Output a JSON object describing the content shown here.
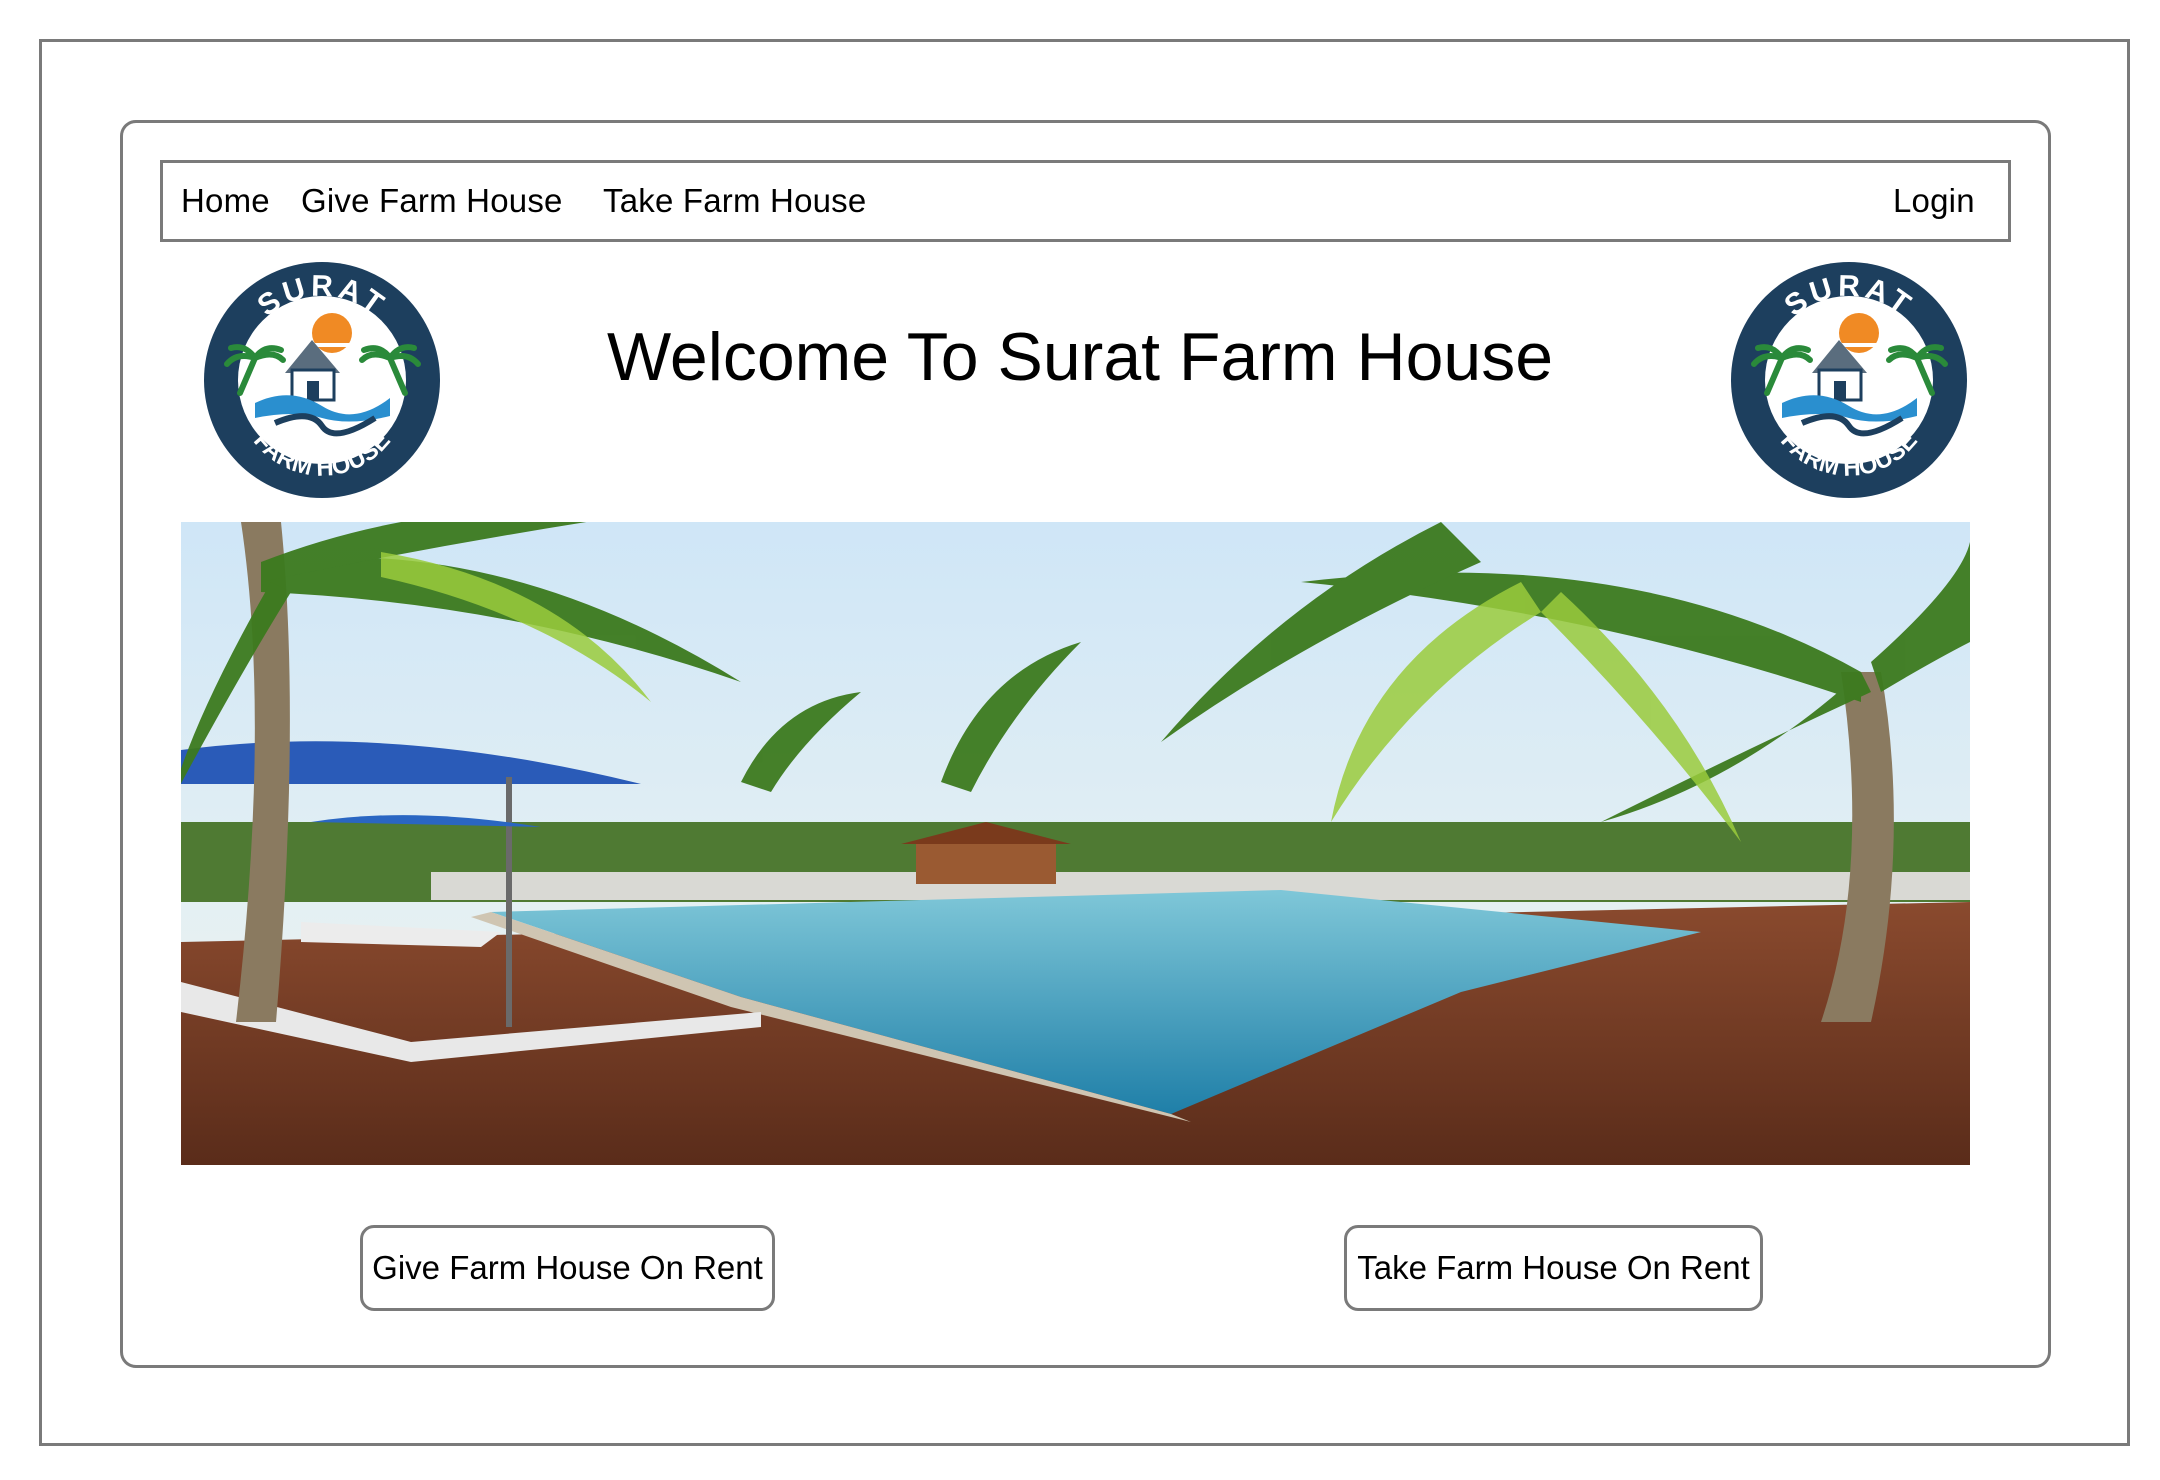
{
  "nav": {
    "home": "Home",
    "give": "Give Farm House",
    "take": "Take Farm House",
    "login": "Login"
  },
  "logo": {
    "top_text": "SURAT",
    "bottom_text": "FARM HOUSE",
    "colors": {
      "navy": "#1d3f5e",
      "sun": "#f08a24",
      "water": "#2a8fcf",
      "palm": "#2a8a3a"
    }
  },
  "hero": {
    "title": "Welcome To Surat Farm House",
    "image_icon": "pool-resort-photo"
  },
  "actions": {
    "give_rent": "Give Farm House On Rent",
    "take_rent": "Take Farm House On Rent"
  },
  "colors": {
    "border": "#7a7a7a",
    "text": "#000000",
    "background": "#ffffff"
  }
}
